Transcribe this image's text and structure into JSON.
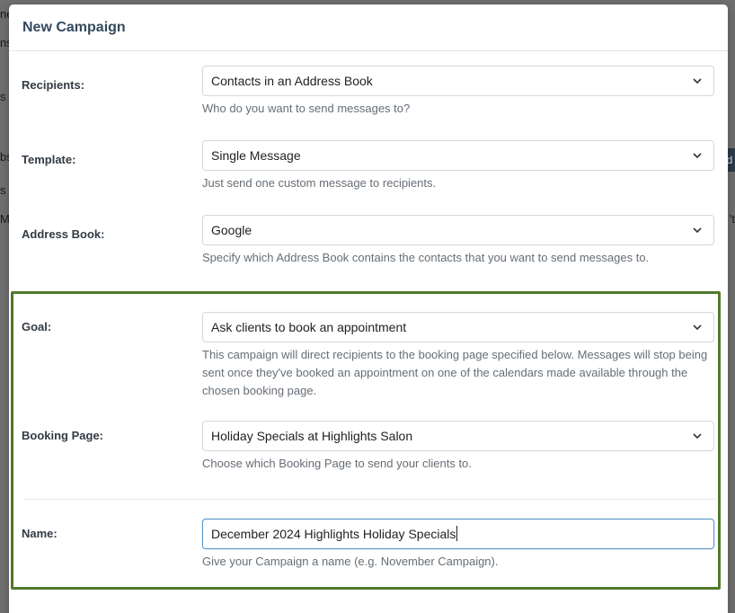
{
  "background": {
    "left_fragments": [
      "ne",
      "ns",
      "s",
      "bs",
      "s",
      "M"
    ],
    "right_fragments": [
      "d",
      "'t"
    ]
  },
  "modal": {
    "title": "New Campaign"
  },
  "form": {
    "recipients": {
      "label": "Recipients:",
      "value": "Contacts in an Address Book",
      "help": "Who do you want to send messages to?"
    },
    "template": {
      "label": "Template:",
      "value": "Single Message",
      "help": "Just send one custom message to recipients."
    },
    "address_book": {
      "label": "Address Book:",
      "value": "Google",
      "help": "Specify which Address Book contains the contacts that you want to send messages to."
    },
    "goal": {
      "label": "Goal:",
      "value": "Ask clients to book an appointment",
      "help": "This campaign will direct recipients to the booking page specified below. Messages will stop being sent once they've booked an appointment on one of the calendars made available through the chosen booking page."
    },
    "booking_page": {
      "label": "Booking Page:",
      "value": "Holiday Specials at Highlights Salon",
      "help": "Choose which Booking Page to send your clients to."
    },
    "name": {
      "label": "Name:",
      "value": "December 2024 Highlights Holiday Specials",
      "help": "Give your Campaign a name (e.g. November Campaign)."
    }
  },
  "colors": {
    "highlight_border": "#4e7a2a",
    "focus_border": "#5b97c9"
  }
}
